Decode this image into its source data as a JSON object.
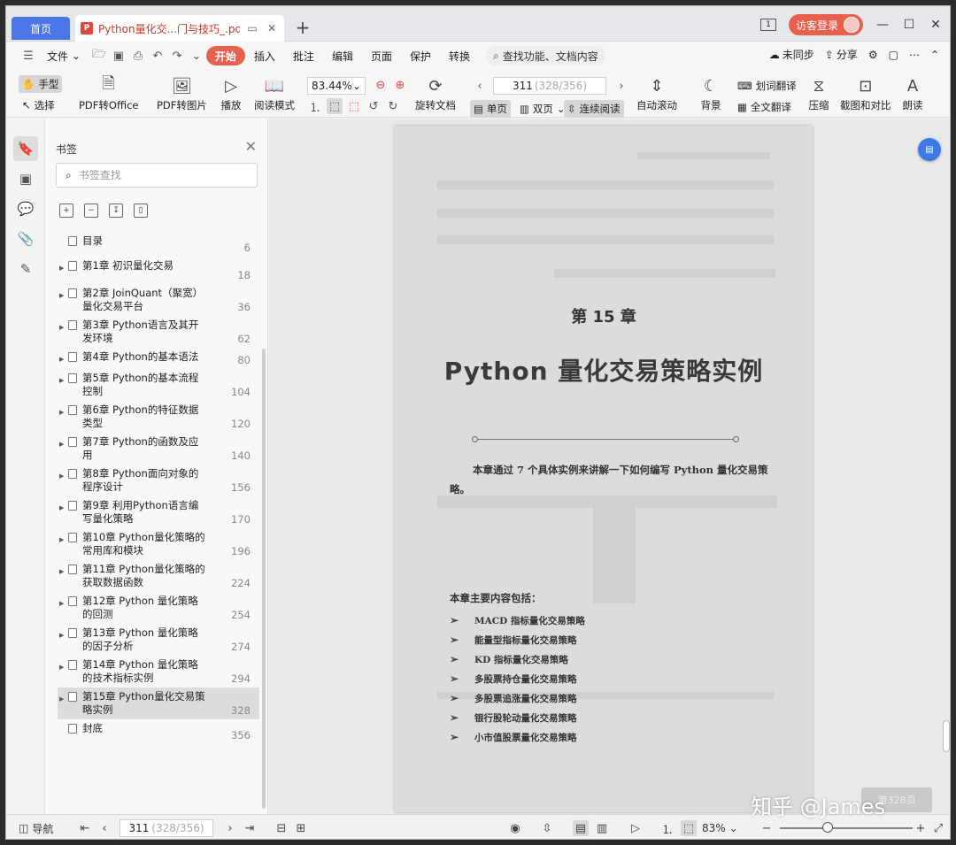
{
  "tabs": {
    "home": "首页",
    "document_title": "Python量化交...门与技巧_.pdf",
    "login": "访客登录"
  },
  "menu": {
    "file": "文件",
    "items": [
      "开始",
      "插入",
      "批注",
      "编辑",
      "页面",
      "保护",
      "转换"
    ],
    "active": "开始",
    "search": "查找功能、文档内容",
    "sync": "未同步",
    "share": "分享"
  },
  "ribbon": {
    "hand": "手型",
    "select": "选择",
    "pdf_to_office": "PDF转Office",
    "pdf_to_image": "PDF转图片",
    "play": "播放",
    "read_mode": "阅读模式",
    "zoom": "83.44%",
    "rotate": "旋转文档",
    "page_current": "311",
    "page_total": "(328/356)",
    "single": "单页",
    "double": "双页",
    "continuous": "连续阅读",
    "auto_scroll": "自动滚动",
    "background": "背景",
    "word_translate": "划词翻译",
    "full_translate": "全文翻译",
    "compress": "压缩",
    "screenshot_compare": "截图和对比",
    "read_aloud": "朗读"
  },
  "bookmarks": {
    "title": "书签",
    "search_placeholder": "书签查找",
    "items": [
      {
        "label": "目录",
        "page": "6",
        "arrow": false
      },
      {
        "label": "第1章 初识量化交易",
        "page": "18",
        "arrow": true
      },
      {
        "label": "第2章 JoinQuant（聚宽）量化交易平台",
        "page": "36",
        "arrow": true
      },
      {
        "label": "第3章 Python语言及其开发环境",
        "page": "62",
        "arrow": true
      },
      {
        "label": "第4章 Python的基本语法",
        "page": "80",
        "arrow": true
      },
      {
        "label": "第5章 Python的基本流程控制",
        "page": "104",
        "arrow": true
      },
      {
        "label": "第6章 Python的特征数据类型",
        "page": "120",
        "arrow": true
      },
      {
        "label": "第7章 Python的函数及应用",
        "page": "140",
        "arrow": true
      },
      {
        "label": "第8章 Python面向对象的程序设计",
        "page": "156",
        "arrow": true
      },
      {
        "label": "第9章 利用Python语言编写量化策略",
        "page": "170",
        "arrow": true
      },
      {
        "label": "第10章 Python量化策略的常用库和模块",
        "page": "196",
        "arrow": true
      },
      {
        "label": "第11章 Python量化策略的获取数据函数",
        "page": "224",
        "arrow": true
      },
      {
        "label": "第12章 Python 量化策略的回测",
        "page": "254",
        "arrow": true
      },
      {
        "label": "第13章 Python 量化策略的因子分析",
        "page": "274",
        "arrow": true
      },
      {
        "label": "第14章 Python 量化策略的技术指标实例",
        "page": "294",
        "arrow": true
      },
      {
        "label": "第15章 Python量化交易策略实例",
        "page": "328",
        "arrow": true
      },
      {
        "label": "封底",
        "page": "356",
        "arrow": false
      }
    ],
    "selected_index": 15
  },
  "page_content": {
    "chapter_no": "第 15 章",
    "chapter_title": "Python 量化交易策略实例",
    "intro": "本章通过 7 个具体实例来讲解一下如何编写 Python 量化交易策略。",
    "contents_head": "本章主要内容包括：",
    "contents": [
      "MACD 指标量化交易策略",
      "能量型指标量化交易策略",
      "KD 指标量化交易策略",
      "多股票持仓量化交易策略",
      "多股票追涨量化交易策略",
      "银行股轮动量化交易策略",
      "小市值股票量化交易策略"
    ],
    "page_float": "第328页"
  },
  "statusbar": {
    "nav": "导航",
    "page_current": "311",
    "page_total": "(328/356)",
    "zoom": "83%"
  },
  "watermark": "知乎 @James",
  "colors": {
    "accent_red": "#e8604f",
    "home_blue": "#4a76e8",
    "pdf_red": "#e0463c"
  }
}
